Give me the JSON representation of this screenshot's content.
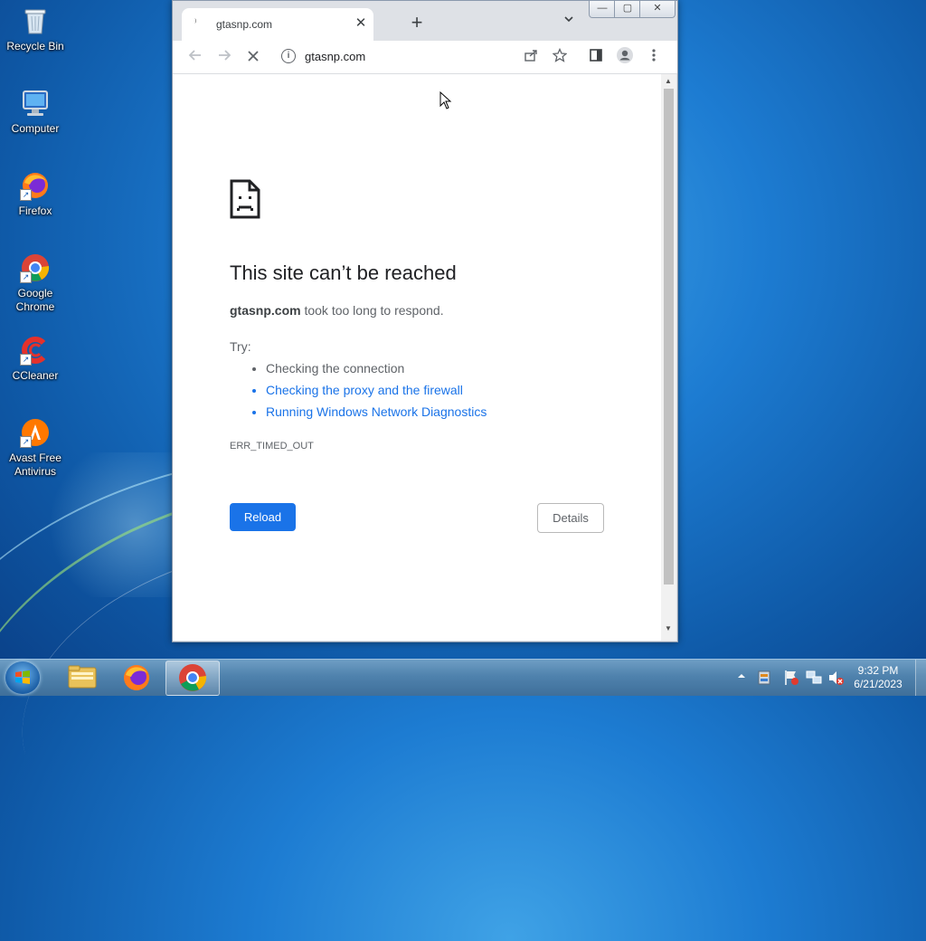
{
  "desktop": {
    "icons": [
      {
        "label": "Recycle Bin"
      },
      {
        "label": "Computer"
      },
      {
        "label": "Firefox"
      },
      {
        "label": "Google Chrome"
      },
      {
        "label": "CCleaner"
      },
      {
        "label": "Avast Free Antivirus"
      }
    ]
  },
  "browser": {
    "tab": {
      "title": "gtasnp.com",
      "close": "✕"
    },
    "new_tab": "+",
    "address": "gtasnp.com",
    "caption": {
      "minimize": "—",
      "maximize": "▢",
      "close": "✕"
    }
  },
  "page": {
    "title": "This site can’t be reached",
    "desc_domain": "gtasnp.com",
    "desc_rest": " took too long to respond.",
    "try_label": "Try:",
    "suggestions": [
      {
        "text": "Checking the connection"
      },
      {
        "text": "Checking the proxy and the firewall"
      },
      {
        "text": "Running Windows Network Diagnostics"
      }
    ],
    "error_code": "ERR_TIMED_OUT",
    "reload_label": "Reload",
    "details_label": "Details"
  },
  "taskbar": {
    "clock_time": "9:32 PM",
    "clock_date": "6/21/2023"
  },
  "colors": {
    "accent_blue": "#1a73e8",
    "text_dark": "#202124",
    "text_muted": "#5f6368"
  }
}
